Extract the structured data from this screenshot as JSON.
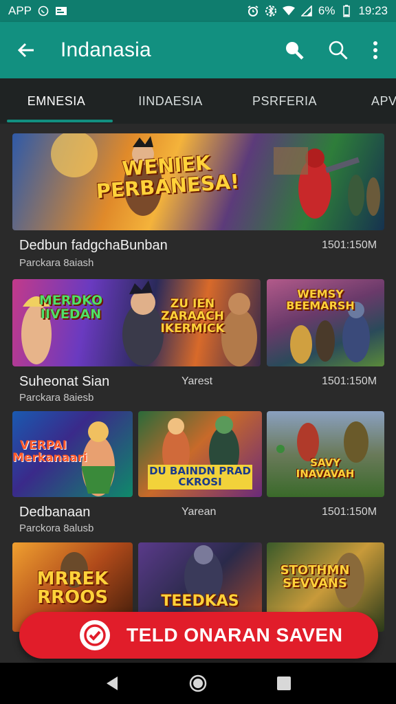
{
  "status_bar": {
    "app_label": "APP",
    "battery": "6%",
    "time": "19:23",
    "icons": [
      "whatsapp-icon",
      "message-icon",
      "alarm-icon",
      "bluetooth-icon",
      "wifi-icon",
      "signal-icon",
      "battery-icon"
    ]
  },
  "app_bar": {
    "title": "Indanasia",
    "back_icon": "arrow-back-icon",
    "actions": [
      "search-icon",
      "search-icon",
      "more-vert-icon"
    ]
  },
  "tabs": [
    {
      "label": "EMNESIA",
      "active": true
    },
    {
      "label": "IINDAESIA",
      "active": false
    },
    {
      "label": "PSRFERIA",
      "active": false
    },
    {
      "label": "APV",
      "active": false
    }
  ],
  "items": [
    {
      "banner_text": "WENIEK PERBANESA!",
      "title": "Dedbun fadgchaBunban",
      "subtitle": "Parckara 8aiash",
      "meta": "1501:150M"
    },
    {
      "tiles": [
        "MERDKO IIVEDAN",
        "ZU IEN ZARAACH IKERMICK",
        "WEMSY BEEMARSH"
      ],
      "title": "Suheonat Sian",
      "middle": "Yarest",
      "subtitle": "Parckara 8aiesb",
      "meta": "1501:150M"
    },
    {
      "tiles": [
        "VERPAI Merkanaari",
        "DU BAINDN PRAD CKROSI",
        "SAVY INAVAVAH"
      ],
      "title": "Dedbanaan",
      "middle": "Yarean",
      "subtitle": "Parckora 8alusb",
      "meta": "1501:150M"
    },
    {
      "tiles": [
        "MRREK RROOS",
        "TEEDKAS",
        "STOTHMN SEVVANS"
      ],
      "title": "",
      "middle": "",
      "subtitle": "",
      "meta": ""
    }
  ],
  "fab": {
    "label": "TELD ONARAN SAVEN",
    "icon": "check-circle-icon",
    "color": "#e11d2a"
  },
  "colors": {
    "primary": "#129080",
    "status_bar": "#0f7d6e",
    "background": "#2a2a2a"
  },
  "nav_bar": {
    "icons": [
      "back-triangle-icon",
      "home-circle-icon",
      "recents-square-icon"
    ]
  }
}
